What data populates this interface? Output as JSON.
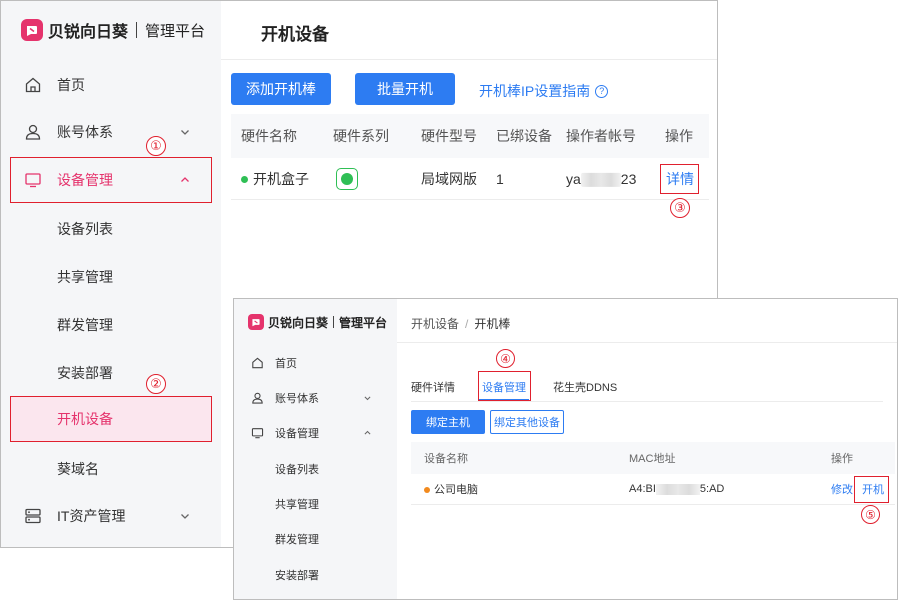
{
  "brand": {
    "name": "贝锐向日葵",
    "subtitle": "管理平台"
  },
  "window1": {
    "page_title": "开机设备",
    "sidebar": {
      "items": [
        {
          "label": "首页",
          "icon": "home-icon"
        },
        {
          "label": "账号体系",
          "icon": "user-icon"
        },
        {
          "label": "设备管理",
          "icon": "monitor-icon"
        },
        {
          "label": "设备列表"
        },
        {
          "label": "共享管理"
        },
        {
          "label": "群发管理"
        },
        {
          "label": "安装部署"
        },
        {
          "label": "开机设备"
        },
        {
          "label": "葵域名"
        },
        {
          "label": "IT资产管理",
          "icon": "server-icon"
        }
      ]
    },
    "toolbar": {
      "add_label": "添加开机棒",
      "batch_label": "批量开机",
      "guide_label": "开机棒IP设置指南",
      "help_symbol": "?"
    },
    "table": {
      "headers": [
        "硬件名称",
        "硬件系列",
        "硬件型号",
        "已绑设备",
        "操作者帐号",
        "操作"
      ],
      "row": {
        "name": "开机盒子",
        "model": "局域网版",
        "bound": "1",
        "account_prefix": "ya",
        "account_suffix": "23",
        "action": "详情"
      }
    }
  },
  "window2": {
    "breadcrumb": {
      "parent": "开机设备",
      "separator": "/",
      "current": "开机棒"
    },
    "sidebar": {
      "items": [
        {
          "label": "首页",
          "icon": "home-icon"
        },
        {
          "label": "账号体系",
          "icon": "user-icon"
        },
        {
          "label": "设备管理",
          "icon": "monitor-icon"
        },
        {
          "label": "设备列表"
        },
        {
          "label": "共享管理"
        },
        {
          "label": "群发管理"
        },
        {
          "label": "安装部署"
        }
      ]
    },
    "tabs": [
      {
        "label": "硬件详情"
      },
      {
        "label": "设备管理"
      },
      {
        "label": "花生壳DDNS"
      }
    ],
    "buttons": {
      "bind_host": "绑定主机",
      "bind_other": "绑定其他设备"
    },
    "table": {
      "headers": [
        "设备名称",
        "MAC地址",
        "操作"
      ],
      "row": {
        "name": "公司电脑",
        "mac_prefix": "A4:BI",
        "mac_suffix": "5:AD",
        "edit": "修改",
        "power_on": "开机"
      }
    }
  },
  "step_markers": [
    "①",
    "②",
    "③",
    "④",
    "⑤"
  ],
  "colors": {
    "accent": "#e5336c",
    "primary": "#2d7cf2",
    "highlight": "#e0202e",
    "online": "#2fbf55",
    "offline": "#f28a1e"
  }
}
